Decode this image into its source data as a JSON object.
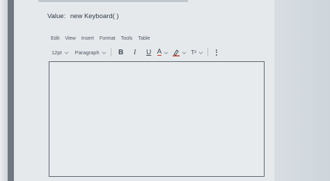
{
  "value_label": "Value:",
  "value_text": "new Keyboard( )",
  "menu": [
    "Edit",
    "View",
    "Insert",
    "Format",
    "Tools",
    "Table"
  ],
  "toolbar": {
    "font_size": "12pt",
    "block_format": "Paragraph",
    "bold_glyph": "B",
    "italic_glyph": "I",
    "underline_glyph": "U",
    "text_color_glyph": "A",
    "superscript_glyph": "T²"
  },
  "editor": {
    "content": ""
  },
  "colors": {
    "accent_red": "#c0392b",
    "text": "#2d3b45",
    "editor_border": "#5a6570"
  },
  "icons": [
    "chevron-down-icon",
    "bold-icon",
    "italic-icon",
    "underline-icon",
    "text-color-icon",
    "highlight-icon",
    "superscript-icon",
    "more-options-icon"
  ]
}
